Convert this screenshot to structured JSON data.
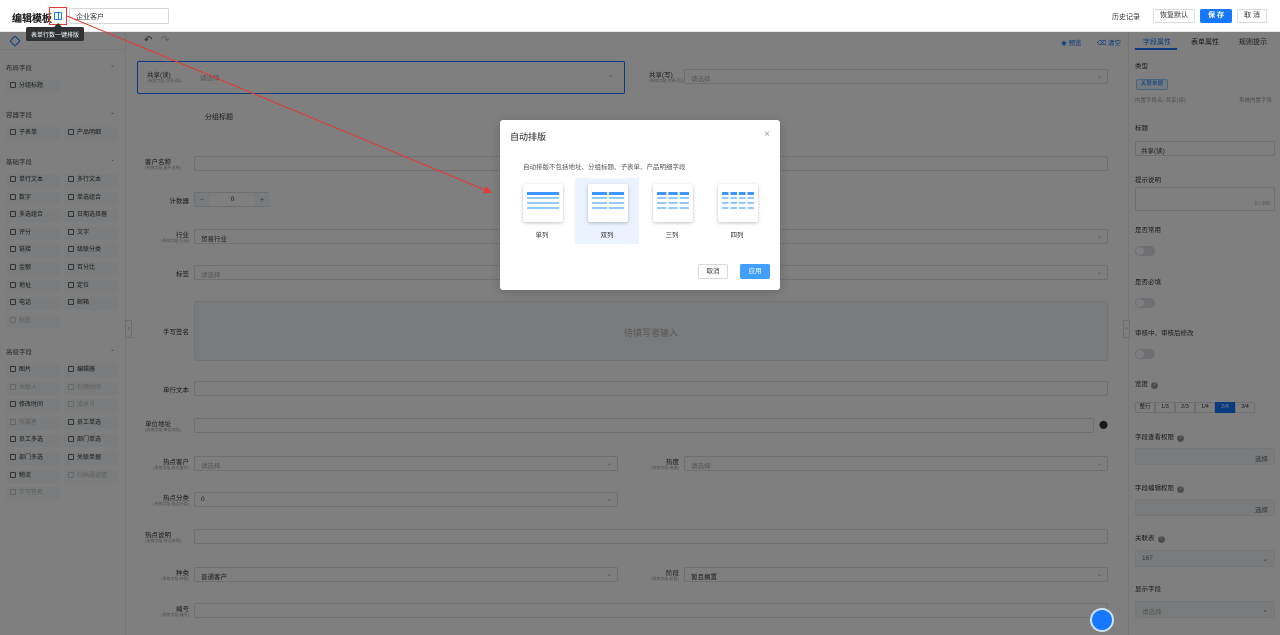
{
  "header": {
    "title": "编辑模板",
    "template_name": "企业客户",
    "tooltip": "表单行数一键排版",
    "history": "历史记录",
    "restore_default": "恢复默认",
    "save": "保 存",
    "cancel": "取 消"
  },
  "left_panel": {
    "sections": [
      {
        "title": "布局字段",
        "items": [
          {
            "label": "分组标题",
            "disabled": false
          }
        ]
      },
      {
        "title": "容器字段",
        "items": [
          {
            "label": "子表单",
            "disabled": false
          },
          {
            "label": "产品明细",
            "disabled": false
          }
        ]
      },
      {
        "title": "基础字段",
        "items": [
          {
            "label": "单行文本",
            "disabled": false
          },
          {
            "label": "多行文本",
            "disabled": false
          },
          {
            "label": "数字",
            "disabled": false
          },
          {
            "label": "单选组合",
            "disabled": false
          },
          {
            "label": "多选组合",
            "disabled": false
          },
          {
            "label": "日期选择器",
            "disabled": false
          },
          {
            "label": "评分",
            "disabled": false
          },
          {
            "label": "文字",
            "disabled": false
          },
          {
            "label": "链接",
            "disabled": false
          },
          {
            "label": "级联分类",
            "disabled": false
          },
          {
            "label": "金额",
            "disabled": false
          },
          {
            "label": "百分比",
            "disabled": false
          },
          {
            "label": "地址",
            "disabled": false
          },
          {
            "label": "定位",
            "disabled": false
          },
          {
            "label": "电话",
            "disabled": false
          },
          {
            "label": "邮箱",
            "disabled": false
          },
          {
            "label": "标签",
            "disabled": true
          }
        ]
      },
      {
        "title": "高级字段",
        "items": [
          {
            "label": "图片",
            "disabled": false
          },
          {
            "label": "编辑器",
            "disabled": false
          },
          {
            "label": "关联人",
            "disabled": true
          },
          {
            "label": "创建时间",
            "disabled": true
          },
          {
            "label": "修改时间",
            "disabled": false
          },
          {
            "label": "流水号",
            "disabled": true
          },
          {
            "label": "所属者",
            "disabled": true
          },
          {
            "label": "员工单选",
            "disabled": false
          },
          {
            "label": "员工多选",
            "disabled": false
          },
          {
            "label": "部门单选",
            "disabled": false
          },
          {
            "label": "部门多选",
            "disabled": false
          },
          {
            "label": "关联单据",
            "disabled": false
          },
          {
            "label": "物流",
            "disabled": false
          },
          {
            "label": "归档通道管",
            "disabled": true
          },
          {
            "label": "手写签名",
            "disabled": true
          }
        ]
      }
    ]
  },
  "center": {
    "preview": "预览",
    "clear": "清空",
    "placeholder": "请选择",
    "fields": {
      "share_read": {
        "label": "共享(读)",
        "sub": "(系统字段-共享(读))"
      },
      "share_write": {
        "label": "共享(写)",
        "sub": "(系统字段-共享(写))"
      },
      "group_title": "分组标题",
      "customer_name": {
        "label": "客户名称",
        "sub": "(系统字段-客户名称)"
      },
      "counter": {
        "label": "计数器",
        "value": "0"
      },
      "industry": {
        "label": "行业",
        "sub": "(系统字段-行业)",
        "value": "贸易行业"
      },
      "tags": {
        "label": "标签"
      },
      "signature": {
        "label": "手写签名",
        "hint": "待填写者输入"
      },
      "single_text": {
        "label": "单行文本"
      },
      "address": {
        "label": "单位地址",
        "sub": "(系统字段-单位地址)"
      },
      "hot_customer": {
        "label": "热点客户",
        "sub": "(系统字段-热点客户)"
      },
      "heat": {
        "label": "热度",
        "sub": "(系统字段-热度)"
      },
      "hot_category": {
        "label": "热点分类",
        "sub": "(系统字段-热点分类)",
        "value": "0"
      },
      "hot_desc": {
        "label": "热点说明",
        "sub": "(系统字段-热点说明)"
      },
      "kind": {
        "label": "种类",
        "sub": "(系统字段-种类)",
        "value": "普通客户"
      },
      "stage": {
        "label": "阶段",
        "sub": "(系统字段-阶段)",
        "value": "暂且搁置"
      },
      "code": {
        "label": "编号",
        "sub": "(系统字段-编号)"
      }
    }
  },
  "modal": {
    "title": "自动排版",
    "description": "自动排版不包括地址、分组标题、子表单、产品明细字段",
    "options": [
      {
        "label": "单列",
        "columns": 1,
        "selected": false
      },
      {
        "label": "双列",
        "columns": 2,
        "selected": true
      },
      {
        "label": "三列",
        "columns": 3,
        "selected": false
      },
      {
        "label": "四列",
        "columns": 4,
        "selected": false
      }
    ],
    "cancel": "取消",
    "apply": "应用"
  },
  "right_panel": {
    "tabs": [
      "字段属性",
      "表单属性",
      "规则提示"
    ],
    "type_label": "类型",
    "type_tag": "关联单据",
    "builtin_field": "内置字段名: 共享(读)",
    "system_builtin": "系统内置字段",
    "title_label": "标题",
    "title_value": "共享(读)",
    "hint_label": "提示说明",
    "hint_count": "0 / 200",
    "common_label": "是否常用",
    "required_label": "是否必填",
    "audit_label": "审核中、审核后修改",
    "width_label": "宽度",
    "width_options": [
      "整行",
      "1/3",
      "2/3",
      "1/4",
      "2/4",
      "3/4"
    ],
    "width_selected": "2/4",
    "view_perm_label": "字段查看权限",
    "edit_perm_label": "字段编辑权限",
    "select_text": "选择",
    "relation_label": "关联表",
    "relation_value": "167",
    "display_label": "显示字段",
    "display_placeholder": "请选择"
  }
}
